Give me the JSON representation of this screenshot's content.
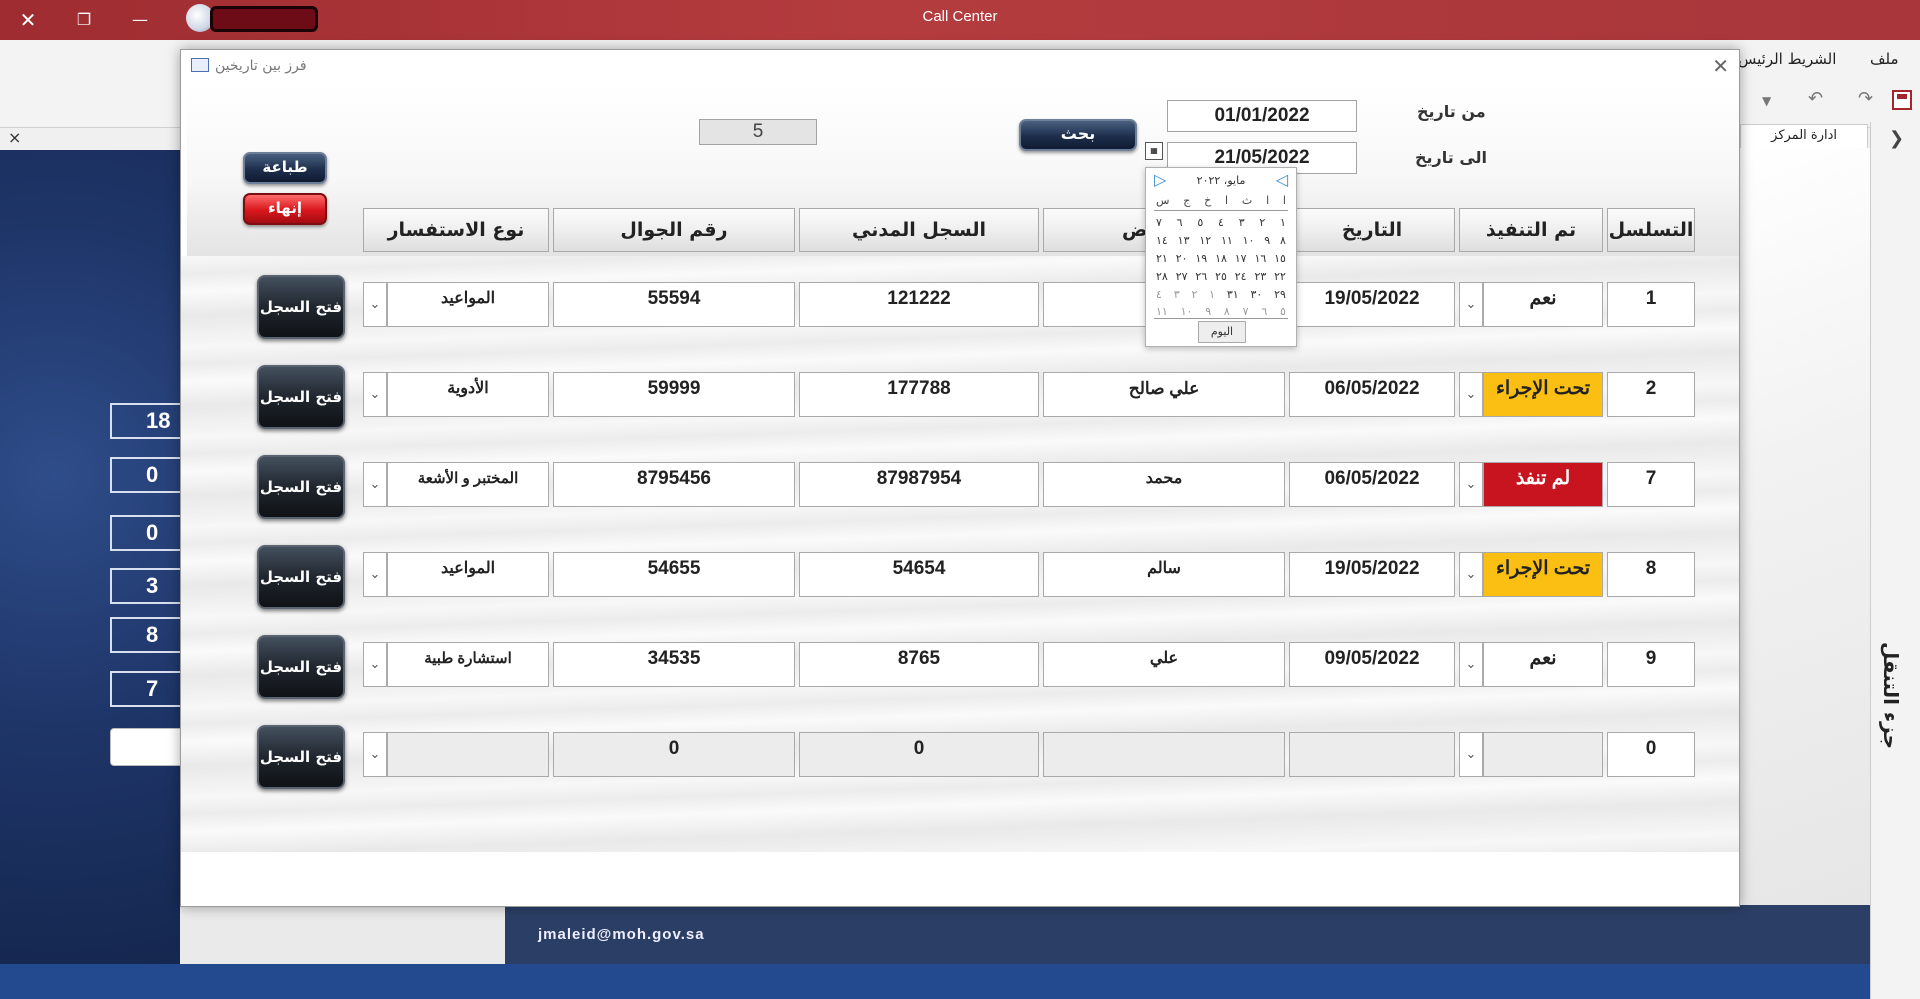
{
  "app": {
    "title": "Call Center",
    "close_glyph": "✕",
    "restore_glyph": "❐",
    "minimize_glyph": "—"
  },
  "ribbon": {
    "tab_file": "ملف",
    "tab_home": "الشريط الرئيس"
  },
  "background": {
    "side_values": [
      "18",
      "0",
      "0",
      "3",
      "8",
      "7"
    ],
    "email": "jmaleid@moh.gov.sa",
    "back_tab": "ادارة المركز",
    "nav_pane_label": "جزء التنقل",
    "close_doc": "×"
  },
  "dialog": {
    "title": "فرز بين تاريخين",
    "close_glyph": "✕",
    "from_label": "من تاريخ",
    "to_label": "الى تاريخ",
    "from_date": "01/01/2022",
    "to_date": "21/05/2022",
    "search_button": "بحث",
    "count": "5",
    "print_button": "طباعة",
    "exit_button": "إنهاء",
    "open_button": "فتح السجل",
    "columns": {
      "serial": "التسلسل",
      "done": "تم التنفيذ",
      "date": "التاريخ",
      "patient": "ض",
      "civil_id": "السجل المدني",
      "mobile": "رقم الجوال",
      "inquiry": "نوع الاستفسار"
    },
    "rows": [
      {
        "serial": "1",
        "done": "نعم",
        "status": "plain",
        "date": "19/05/2022",
        "patient": "",
        "civil_id": "121222",
        "mobile": "55594",
        "inquiry": "المواعيد"
      },
      {
        "serial": "2",
        "done": "تحت الإجراء",
        "status": "yellow",
        "date": "06/05/2022",
        "patient": "علي صالح",
        "civil_id": "177788",
        "mobile": "59999",
        "inquiry": "الأدوية"
      },
      {
        "serial": "7",
        "done": "لم تنفذ",
        "status": "red",
        "date": "06/05/2022",
        "patient": "محمد",
        "civil_id": "87987954",
        "mobile": "8795456",
        "inquiry": "المختبر و الأشعة"
      },
      {
        "serial": "8",
        "done": "تحت الإجراء",
        "status": "yellow",
        "date": "19/05/2022",
        "patient": "سالم",
        "civil_id": "54654",
        "mobile": "54655",
        "inquiry": "المواعيد"
      },
      {
        "serial": "9",
        "done": "نعم",
        "status": "plain",
        "date": "09/05/2022",
        "patient": "علي",
        "civil_id": "8765",
        "mobile": "34535",
        "inquiry": "استشارة طبية"
      },
      {
        "serial": "0",
        "done": "",
        "status": "gray",
        "date": "",
        "patient": "",
        "civil_id": "0",
        "mobile": "0",
        "inquiry": ""
      }
    ]
  },
  "calendar": {
    "month": "مايو، ٢٠٢٢",
    "days_of_week": [
      "ا",
      "ا",
      "ث",
      "ا",
      "خ",
      "ج",
      "س"
    ],
    "weeks": [
      [
        "١",
        "٢",
        "٣",
        "٤",
        "٥",
        "٦",
        "٧"
      ],
      [
        "٨",
        "٩",
        "١٠",
        "١١",
        "١٢",
        "١٣",
        "١٤"
      ],
      [
        "١٥",
        "١٦",
        "١٧",
        "١٨",
        "١٩",
        "٢٠",
        "٢١"
      ],
      [
        "٢٢",
        "٢٣",
        "٢٤",
        "٢٥",
        "٢٦",
        "٢٧",
        "٢٨"
      ],
      [
        "٢٩",
        "٣٠",
        "٣١",
        "١",
        "٢",
        "٣",
        "٤"
      ],
      [
        "٥",
        "٦",
        "٧",
        "٨",
        "٩",
        "١٠",
        "١١"
      ]
    ],
    "today_button": "اليوم",
    "prev_glyph": "◁",
    "next_glyph": "▷"
  },
  "icons": {
    "dropdown": "⌄",
    "nav_chevron": "❯"
  }
}
